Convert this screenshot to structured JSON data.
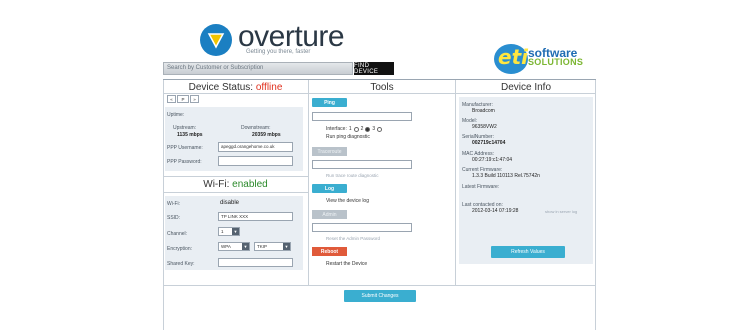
{
  "header": {
    "brand": "overture",
    "tagline": "Getting you there, faster",
    "search_placeholder": "Search by Customer or Subscription",
    "find_label": "FIND DEVICE",
    "partner_logo_text": "eti",
    "partner_software": "software",
    "partner_solutions": "SOLUTIONS"
  },
  "device_status": {
    "title": "Device Status:",
    "state": "offline",
    "pager": [
      "«",
      "P",
      "»"
    ],
    "section_label": "Uptime:",
    "upstream_label": "Upstream:",
    "upstream_value": "1135 mbps",
    "downstream_label": "Downstream:",
    "downstream_value": "20359 mbps",
    "ppp_username_label": "PPP Username:",
    "ppp_username_value": "apeggd.orangehome.co.uk",
    "ppp_password_label": "PPP Password:",
    "ppp_password_value": ""
  },
  "wifi": {
    "title": "Wi-Fi:",
    "state": "enabled",
    "wifi_label": "Wi-Fi:",
    "wifi_value": "disable",
    "ssid_label": "SSID:",
    "ssid_value": "TP LINK XXX",
    "channel_label": "Channel:",
    "channel_value": "1",
    "encryption_label": "Encryption:",
    "encryption_value": "WPA",
    "encryption_value2": "TKIP",
    "shared_key_label": "Shared Key:",
    "shared_key_value": ""
  },
  "tools": {
    "title": "Tools",
    "ping_label": "Ping",
    "ping_input": "",
    "interface_label": "Interface:",
    "interface_options": [
      "1",
      "2",
      "3"
    ],
    "interface_selected": 2,
    "run_ping": "Run ping diagnostic",
    "traceroute_label": "Traceroute",
    "traceroute_input": "",
    "run_traceroute": "Run trace route diagnostic",
    "log_label": "Log",
    "view_log": "View the device log",
    "admin_label": "Admin",
    "admin_input": "",
    "reset_admin": "Reset the Admin Password",
    "reboot_label": "Reboot",
    "restart": "Restart the Device",
    "submit_label": "Submit Changes"
  },
  "device_info": {
    "title": "Device Info",
    "manufacturer_label": "Manufacturer:",
    "manufacturer_value": "Broadcom",
    "model_label": "Model:",
    "model_value": "96358VW2",
    "serial_label": "SerialNumber:",
    "serial_value": "002719c14704",
    "mac_label": "MAC Address:",
    "mac_value": "00:27:19:c1:47:04",
    "firmware_label": "Current Firmware:",
    "firmware_value": "1.3.3 Build 110113 Rel.75742n",
    "latest_label": "Latest Firmware:",
    "latest_value": "",
    "contacted_label": "Last contacted on:",
    "contacted_value": "2012-03-14 07:19:28",
    "contacted_link": "show in server log",
    "refresh_label": "Refresh Values"
  }
}
